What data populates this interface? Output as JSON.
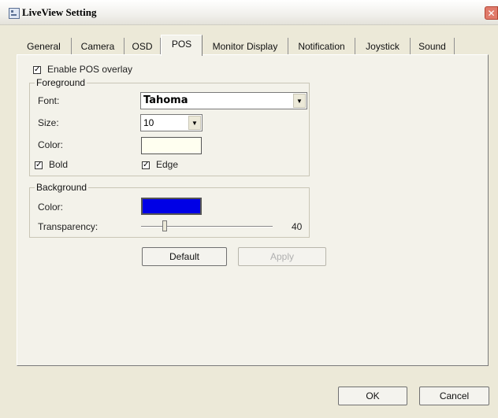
{
  "window": {
    "title": "LiveView Setting",
    "close_glyph": "✕"
  },
  "tabs": [
    {
      "label": "General",
      "active": false
    },
    {
      "label": "Camera",
      "active": false
    },
    {
      "label": "OSD",
      "active": false
    },
    {
      "label": "POS",
      "active": true
    },
    {
      "label": "Monitor Display",
      "active": false
    },
    {
      "label": "Notification",
      "active": false
    },
    {
      "label": "Joystick",
      "active": false
    },
    {
      "label": "Sound",
      "active": false
    }
  ],
  "pos": {
    "enable_overlay": {
      "label": "Enable POS overlay",
      "checked": true
    },
    "foreground": {
      "title": "Foreground",
      "font_label": "Font:",
      "font_value": "Tahoma",
      "size_label": "Size:",
      "size_value": "10",
      "color_label": "Color:",
      "color_value": "#fffff0",
      "bold": {
        "label": "Bold",
        "checked": true
      },
      "edge": {
        "label": "Edge",
        "checked": true
      }
    },
    "background": {
      "title": "Background",
      "color_label": "Color:",
      "color_value": "#0000e6",
      "transparency_label": "Transparency:",
      "transparency_value": "40",
      "transparency_fraction": 0.18
    },
    "default_button": "Default",
    "apply_button": "Apply"
  },
  "footer": {
    "ok_button": "OK",
    "cancel_button": "Cancel"
  },
  "check_glyph": "✓",
  "arrow_glyph": "▼"
}
